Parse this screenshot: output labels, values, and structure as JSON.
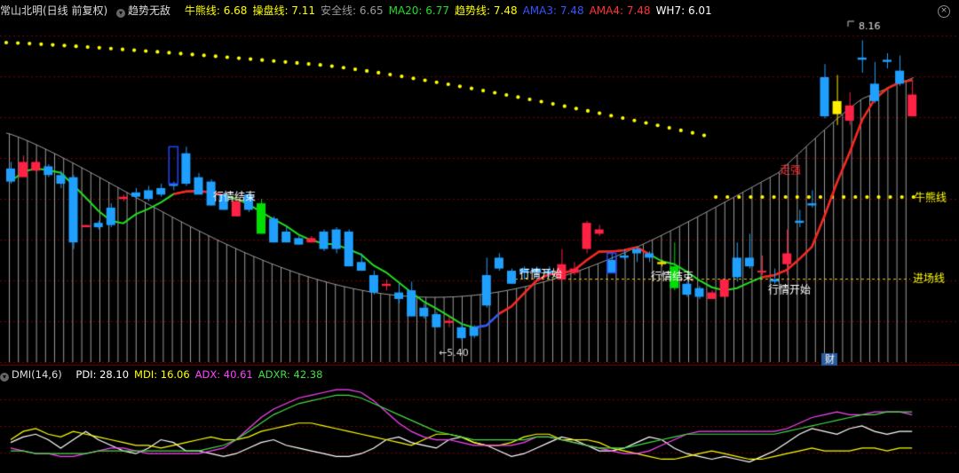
{
  "header": {
    "title": "常山北明(日线 前复权)",
    "indicator_name": "趋势无敌",
    "indicators": [
      {
        "text": "牛熊线: 6.68",
        "color": "#ffff00"
      },
      {
        "text": "操盘线: 7.11",
        "color": "#ffff00"
      },
      {
        "text": "安全线: 6.65",
        "color": "#9a9a9a"
      },
      {
        "text": "MA20: 6.77",
        "color": "#22dd22"
      },
      {
        "text": "趋势线: 7.48",
        "color": "#ffff00"
      },
      {
        "text": "AMA3: 7.48",
        "color": "#3355ff"
      },
      {
        "text": "AMA4: 7.48",
        "color": "#ff3333"
      },
      {
        "text": "WH7: 6.01",
        "color": "#ffffff"
      }
    ]
  },
  "chart_labels": {
    "max_price": "8.16",
    "min_price": "5.40",
    "market_end_1": "行情结束",
    "market_start_1": "行情开始",
    "market_end_2": "行情结束",
    "market_start_2": "行情开始",
    "strong_label": "走强",
    "bull_bear_label": "牛熊线",
    "entry_label": "进场线",
    "finance_marker": "财"
  },
  "sub_header": {
    "name": "DMI(14,6)",
    "items": [
      {
        "text": "PDI: 28.10",
        "color": "#ffffff"
      },
      {
        "text": "MDI: 16.06",
        "color": "#ffff00"
      },
      {
        "text": "ADX: 40.61",
        "color": "#ff44ff"
      },
      {
        "text": "ADXR: 42.38",
        "color": "#44dd44"
      }
    ]
  },
  "colors": {
    "up": "#ff2244",
    "down": "#1fa0ff",
    "bull_bear_dots": "#ffff00",
    "ma20": "#22dd22",
    "trend": "#ff2222",
    "grid": "#7a0000"
  },
  "chart_data": {
    "type": "candlestick",
    "ohlc": [
      [
        6.98,
        7.04,
        6.84,
        6.86
      ],
      [
        6.9,
        7.1,
        6.92,
        7.04
      ],
      [
        6.96,
        7.06,
        6.96,
        7.04
      ],
      [
        7.0,
        7.02,
        6.9,
        6.92
      ],
      [
        6.92,
        6.96,
        6.8,
        6.84
      ],
      [
        6.9,
        6.92,
        6.24,
        6.3
      ],
      [
        6.44,
        6.46,
        6.44,
        6.46
      ],
      [
        6.48,
        6.5,
        6.42,
        6.44
      ],
      [
        6.62,
        6.66,
        6.44,
        6.46
      ],
      [
        6.7,
        6.74,
        6.68,
        6.72
      ],
      [
        6.76,
        6.8,
        6.7,
        6.72
      ],
      [
        6.78,
        6.82,
        6.68,
        6.7
      ],
      [
        6.8,
        6.84,
        6.72,
        6.74
      ],
      [
        6.82,
        6.86,
        6.78,
        6.84
      ],
      [
        7.12,
        7.18,
        6.82,
        6.84
      ],
      [
        6.9,
        6.94,
        6.74,
        6.74
      ],
      [
        6.86,
        6.88,
        6.64,
        6.64
      ],
      [
        6.74,
        6.76,
        6.6,
        6.6
      ],
      [
        6.54,
        6.72,
        6.54,
        6.68
      ],
      [
        6.74,
        6.76,
        6.58,
        6.6
      ],
      [
        6.66,
        6.7,
        6.38,
        6.38
      ],
      [
        6.52,
        6.54,
        6.3,
        6.3
      ],
      [
        6.4,
        6.44,
        6.3,
        6.3
      ],
      [
        6.34,
        6.36,
        6.28,
        6.28
      ],
      [
        6.3,
        6.36,
        6.3,
        6.34
      ],
      [
        6.4,
        6.42,
        6.22,
        6.24
      ],
      [
        6.42,
        6.44,
        6.2,
        6.24
      ],
      [
        6.4,
        6.42,
        6.08,
        6.08
      ],
      [
        6.12,
        6.2,
        6.04,
        6.04
      ],
      [
        6.0,
        6.04,
        5.82,
        5.84
      ],
      [
        5.9,
        5.96,
        5.86,
        5.92
      ],
      [
        5.84,
        5.92,
        5.74,
        5.78
      ],
      [
        5.86,
        5.94,
        5.62,
        5.62
      ],
      [
        5.7,
        5.74,
        5.6,
        5.62
      ],
      [
        5.64,
        5.66,
        5.52,
        5.52
      ],
      [
        5.56,
        5.62,
        5.52,
        5.58
      ],
      [
        5.52,
        5.56,
        5.4,
        5.42
      ],
      [
        5.52,
        5.54,
        5.42,
        5.44
      ],
      [
        6.0,
        6.16,
        5.7,
        5.72
      ],
      [
        6.16,
        6.2,
        6.04,
        6.06
      ],
      [
        6.04,
        6.06,
        5.92,
        5.92
      ],
      [
        6.06,
        6.08,
        5.96,
        6.02
      ],
      [
        6.06,
        6.08,
        5.96,
        6.02
      ],
      [
        6.04,
        6.08,
        5.98,
        6.02
      ],
      [
        5.96,
        6.24,
        5.96,
        6.1
      ],
      [
        6.02,
        6.12,
        6.0,
        6.06
      ],
      [
        6.24,
        6.5,
        6.2,
        6.48
      ],
      [
        6.38,
        6.46,
        6.36,
        6.42
      ],
      [
        6.14,
        6.2,
        6.02,
        6.02
      ],
      [
        6.18,
        6.24,
        6.14,
        6.16
      ],
      [
        6.24,
        6.26,
        6.12,
        6.2
      ],
      [
        6.2,
        6.22,
        6.12,
        6.16
      ],
      [
        6.12,
        6.14,
        6.08,
        6.1
      ],
      [
        6.08,
        6.3,
        5.86,
        5.88
      ],
      [
        5.92,
        5.94,
        5.8,
        5.82
      ],
      [
        5.88,
        5.9,
        5.78,
        5.8
      ],
      [
        5.78,
        5.86,
        5.78,
        5.84
      ],
      [
        5.8,
        5.96,
        5.8,
        5.96
      ],
      [
        6.16,
        6.3,
        5.94,
        5.98
      ],
      [
        6.16,
        6.38,
        6.06,
        6.08
      ],
      [
        6.04,
        6.18,
        6.0,
        6.04
      ],
      [
        5.96,
        6.06,
        5.92,
        5.94
      ],
      [
        6.1,
        6.42,
        6.0,
        6.2
      ],
      [
        6.5,
        6.6,
        6.44,
        6.48
      ],
      [
        6.66,
        6.78,
        6.62,
        6.64
      ],
      [
        7.82,
        7.94,
        7.44,
        7.46
      ],
      [
        7.6,
        7.84,
        7.38,
        7.48
      ],
      [
        7.42,
        7.68,
        7.38,
        7.56
      ],
      [
        8.0,
        8.16,
        7.86,
        7.98
      ],
      [
        7.76,
        7.96,
        7.58,
        7.6
      ],
      [
        7.98,
        8.04,
        7.9,
        7.96
      ],
      [
        7.88,
        8.02,
        7.74,
        7.76
      ],
      [
        7.46,
        7.8,
        7.46,
        7.66
      ]
    ],
    "price_range": [
      5.2,
      8.35
    ],
    "highlighted_candles": [
      {
        "index": 20,
        "color": "#00dd00"
      },
      {
        "index": 52,
        "color": "#ffdd00"
      },
      {
        "index": 53,
        "color": "#00dd00"
      },
      {
        "index": 66,
        "color": "#ffee00"
      }
    ],
    "dmi": {
      "range": [
        0,
        60
      ],
      "PDI": [
        20,
        24,
        26,
        22,
        16,
        22,
        28,
        22,
        18,
        14,
        12,
        16,
        22,
        20,
        14,
        14,
        12,
        10,
        12,
        16,
        20,
        22,
        18,
        16,
        14,
        12,
        10,
        10,
        12,
        16,
        22,
        24,
        20,
        18,
        16,
        22,
        24,
        20,
        18,
        14,
        10,
        12,
        16,
        20,
        24,
        22,
        18,
        14,
        14,
        16,
        20,
        24,
        22,
        16,
        12,
        10,
        8,
        10,
        8,
        6,
        10,
        14,
        20,
        26,
        30,
        28,
        26,
        30,
        32,
        28,
        26,
        28,
        28
      ],
      "MDI": [
        22,
        28,
        30,
        26,
        24,
        28,
        26,
        24,
        22,
        20,
        18,
        18,
        16,
        18,
        20,
        22,
        24,
        22,
        22,
        24,
        28,
        30,
        32,
        34,
        34,
        32,
        30,
        28,
        26,
        24,
        22,
        20,
        18,
        22,
        26,
        26,
        24,
        20,
        18,
        18,
        20,
        24,
        26,
        26,
        22,
        22,
        22,
        20,
        16,
        14,
        12,
        10,
        8,
        8,
        10,
        12,
        14,
        12,
        10,
        8,
        8,
        10,
        12,
        14,
        16,
        14,
        14,
        14,
        16,
        16,
        14,
        16,
        16
      ],
      "ADX": [
        16,
        14,
        12,
        12,
        10,
        10,
        12,
        14,
        16,
        16,
        14,
        12,
        12,
        12,
        12,
        12,
        14,
        16,
        22,
        30,
        38,
        44,
        48,
        52,
        54,
        56,
        58,
        58,
        56,
        50,
        42,
        34,
        28,
        24,
        22,
        22,
        20,
        18,
        18,
        18,
        18,
        20,
        24,
        24,
        22,
        20,
        18,
        16,
        14,
        12,
        12,
        14,
        18,
        22,
        26,
        28,
        28,
        28,
        28,
        28,
        28,
        28,
        30,
        34,
        38,
        40,
        42,
        40,
        40,
        42,
        42,
        42,
        40
      ],
      "ADXR": [
        14,
        14,
        12,
        12,
        12,
        12,
        12,
        14,
        14,
        14,
        14,
        14,
        14,
        14,
        14,
        14,
        16,
        18,
        22,
        28,
        34,
        40,
        44,
        48,
        50,
        52,
        54,
        54,
        52,
        48,
        44,
        40,
        36,
        32,
        28,
        26,
        24,
        22,
        22,
        22,
        22,
        22,
        24,
        24,
        22,
        20,
        18,
        16,
        16,
        16,
        18,
        20,
        22,
        24,
        26,
        26,
        26,
        26,
        26,
        26,
        26,
        26,
        28,
        30,
        32,
        34,
        36,
        38,
        40,
        40,
        42,
        42,
        42
      ]
    }
  }
}
